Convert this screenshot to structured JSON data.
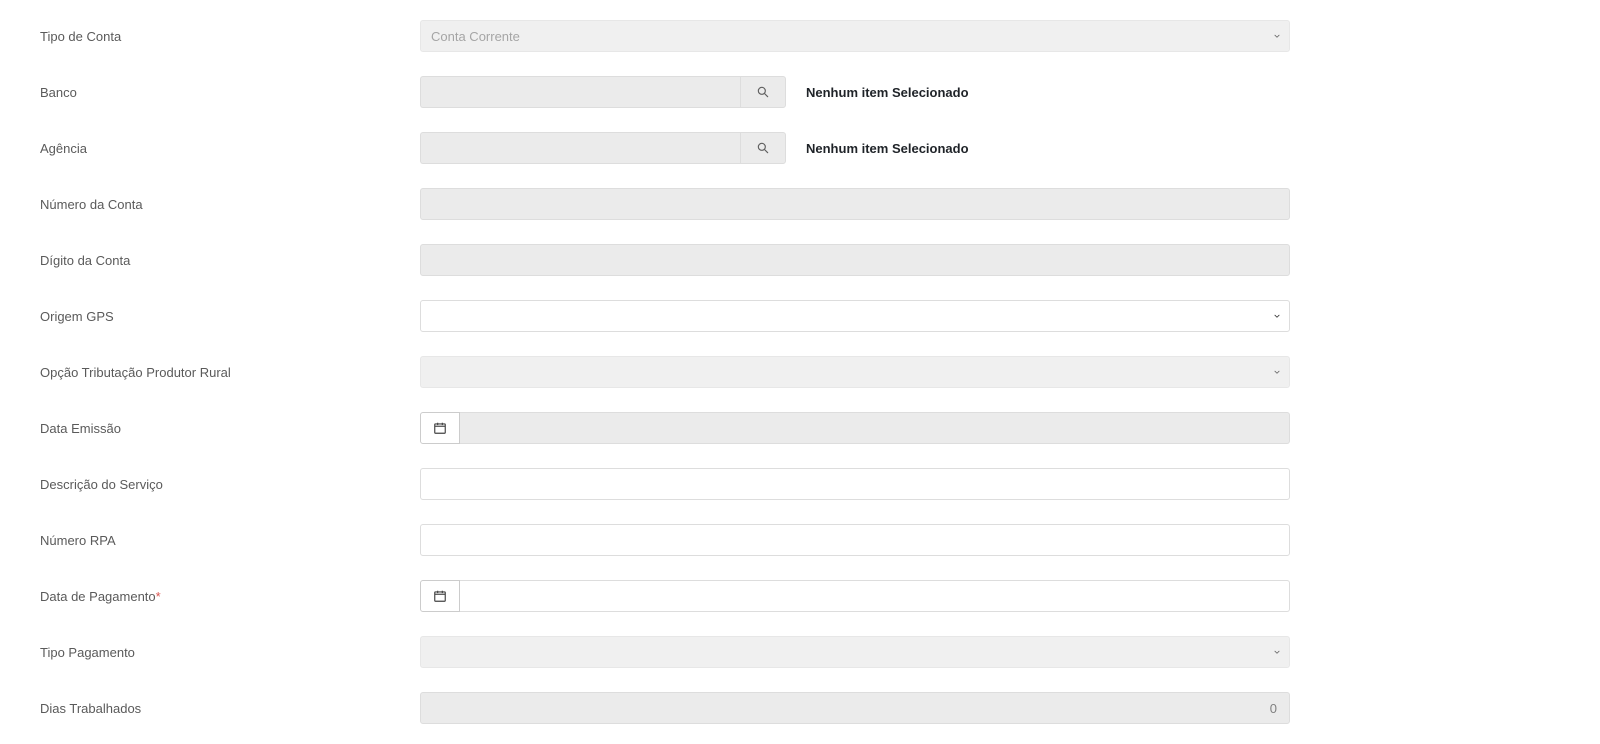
{
  "labels": {
    "tipoConta": "Tipo de Conta",
    "banco": "Banco",
    "agencia": "Agência",
    "numeroConta": "Número da Conta",
    "digitoConta": "Dígito da Conta",
    "origemGps": "Origem GPS",
    "opcaoTributacao": "Opção Tributação Produtor Rural",
    "dataEmissao": "Data Emissão",
    "descricaoServico": "Descrição do Serviço",
    "numeroRpa": "Número RPA",
    "dataPagamento": "Data de Pagamento",
    "tipoPagamento": "Tipo Pagamento",
    "diasTrabalhados": "Dias Trabalhados"
  },
  "values": {
    "tipoContaSelected": "Conta Corrente",
    "bancoStatus": "Nenhum item Selecionado",
    "agenciaStatus": "Nenhum item Selecionado",
    "diasTrabalhados": "0"
  },
  "markers": {
    "required": "*"
  }
}
